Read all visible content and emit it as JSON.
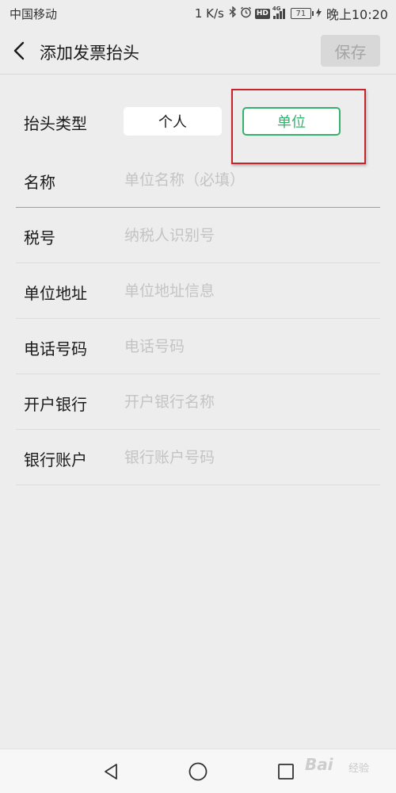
{
  "status_bar": {
    "carrier": "中国移动",
    "speed": "1 K/s",
    "network": "4G",
    "hd": "HD",
    "battery": "71",
    "time": "晚上10:20"
  },
  "header": {
    "title": "添加发票抬头",
    "save_label": "保存"
  },
  "form": {
    "type_row": {
      "label": "抬头类型",
      "options": [
        "个人",
        "单位"
      ],
      "selected": "单位"
    },
    "fields": [
      {
        "label": "名称",
        "placeholder": "单位名称（必填）",
        "value": ""
      },
      {
        "label": "税号",
        "placeholder": "纳税人识别号",
        "value": ""
      },
      {
        "label": "单位地址",
        "placeholder": "单位地址信息",
        "value": ""
      },
      {
        "label": "电话号码",
        "placeholder": "电话号码",
        "value": ""
      },
      {
        "label": "开户银行",
        "placeholder": "开户银行名称",
        "value": ""
      },
      {
        "label": "银行账户",
        "placeholder": "银行账户号码",
        "value": ""
      }
    ]
  },
  "colors": {
    "accent": "#35b16e",
    "annotation": "#c8222a",
    "background": "#ededed"
  },
  "watermark": {
    "text": "Bai",
    "sub": "经验"
  },
  "icons": [
    "back-arrow-icon",
    "bluetooth-icon",
    "alarm-icon",
    "signal-icon",
    "battery-icon",
    "nav-back-icon",
    "nav-home-icon",
    "nav-recent-icon"
  ]
}
